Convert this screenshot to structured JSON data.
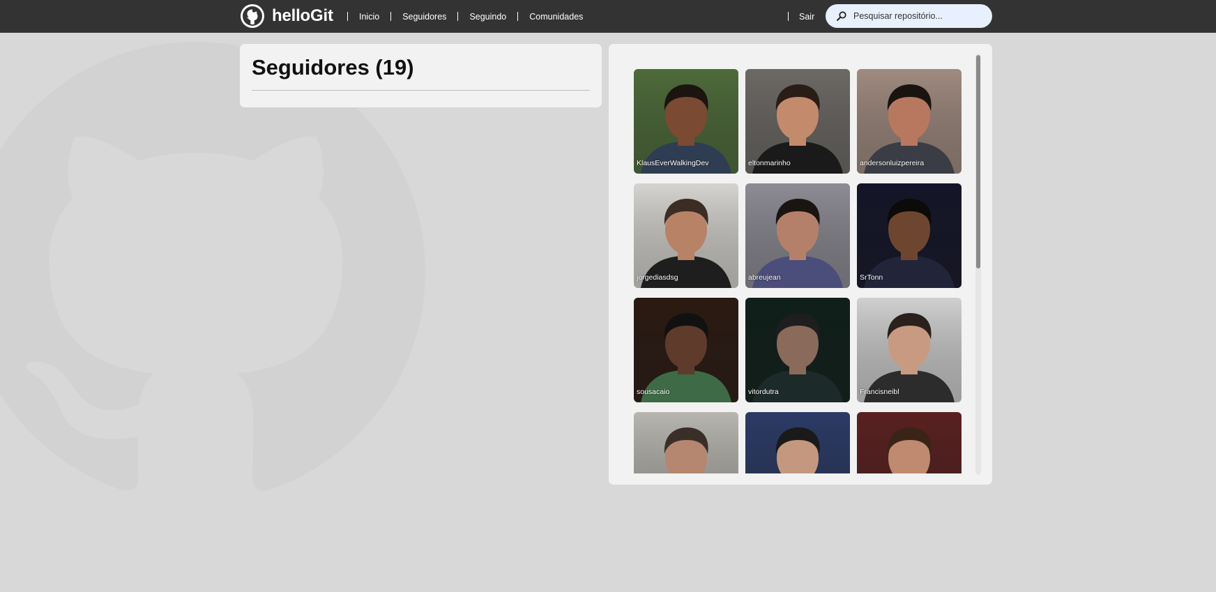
{
  "app": {
    "brand_name": "helloGit"
  },
  "nav": {
    "items": [
      {
        "label": "Inicio"
      },
      {
        "label": "Seguidores"
      },
      {
        "label": "Seguindo"
      },
      {
        "label": "Comunidades"
      }
    ],
    "logout_label": "Sair"
  },
  "search": {
    "placeholder": "Pesquisar repositório...",
    "value": ""
  },
  "page": {
    "title": "Seguidores (19)"
  },
  "followers": [
    {
      "username": "KlausEverWalkingDev",
      "bg": "#4e6b3a",
      "skin": "#7a4a32",
      "hair": "#1c1410",
      "shirt": "#2f3d52"
    },
    {
      "username": "eltonmarinho",
      "bg": "#6d6a66",
      "skin": "#c38a6c",
      "hair": "#2a1d16",
      "shirt": "#1a1a1a"
    },
    {
      "username": "andersonluizpereira",
      "bg": "#a08b80",
      "skin": "#b87860",
      "hair": "#1a1411",
      "shirt": "#3a3d45"
    },
    {
      "username": "jorgediasdsg",
      "bg": "#d6d4d0",
      "skin": "#b78266",
      "hair": "#3b2d24",
      "shirt": "#1e1e1e"
    },
    {
      "username": "abreujean",
      "bg": "#8e8c95",
      "skin": "#b5806a",
      "hair": "#1b1512",
      "shirt": "#4b4d7a"
    },
    {
      "username": "SrTonn",
      "bg": "#141528",
      "skin": "#6e4630",
      "hair": "#0d0b0a",
      "shirt": "#22253a"
    },
    {
      "username": "sousacaio",
      "bg": "#2b1a12",
      "skin": "#5e3b2a",
      "hair": "#111111",
      "shirt": "#3e6b45"
    },
    {
      "username": "vitordutra",
      "bg": "#0f1f1a",
      "skin": "#8a6a5a",
      "hair": "#1e1e1e",
      "shirt": "#1c2a2a"
    },
    {
      "username": "Francisneibl",
      "bg": "#d0d0d0",
      "skin": "#c99a82",
      "hair": "#2a211c",
      "shirt": "#2c2c2c"
    },
    {
      "username": "",
      "bg": "#b8b6b0",
      "skin": "#b58670",
      "hair": "#3a2f28",
      "shirt": "#444"
    },
    {
      "username": "",
      "bg": "#2b3b66",
      "skin": "#c4987e",
      "hair": "#1a1a1a",
      "shirt": "#303030"
    },
    {
      "username": "",
      "bg": "#5a2020",
      "skin": "#c08a70",
      "hair": "#3a2418",
      "shirt": "#8a8a70"
    }
  ],
  "colors": {
    "topbar": "#333333",
    "page_bg": "#d8d8d8",
    "panel_bg": "#f2f2f2",
    "search_bg": "#e8f0fe"
  }
}
